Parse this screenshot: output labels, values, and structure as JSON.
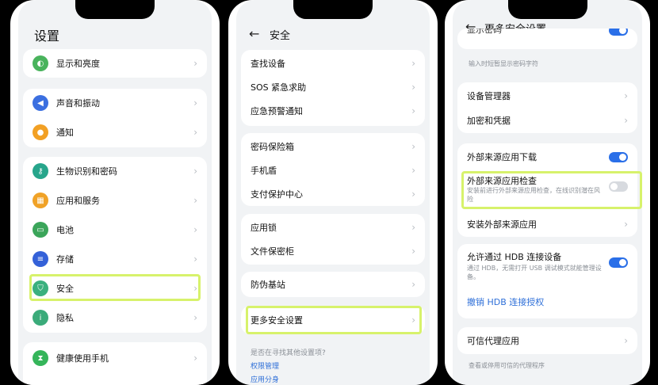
{
  "screen1": {
    "title": "设置",
    "groups": [
      [
        {
          "label": "显示和亮度",
          "icon": "display-icon",
          "color": "#49b35c"
        }
      ],
      [
        {
          "label": "声音和振动",
          "icon": "speaker-icon",
          "color": "#3b6fe0"
        },
        {
          "label": "通知",
          "icon": "bell-icon",
          "color": "#f2a024"
        }
      ],
      [
        {
          "label": "生物识别和密码",
          "icon": "key-icon",
          "color": "#27a58b"
        },
        {
          "label": "应用和服务",
          "icon": "apps-icon",
          "color": "#f0a227"
        },
        {
          "label": "电池",
          "icon": "battery-icon",
          "color": "#3ba55a"
        },
        {
          "label": "存储",
          "icon": "storage-icon",
          "color": "#3461d8"
        },
        {
          "label": "安全",
          "icon": "shield-icon",
          "color": "#3ab07e"
        },
        {
          "label": "隐私",
          "icon": "privacy-icon",
          "color": "#3bab7a"
        }
      ],
      [
        {
          "label": "健康使用手机",
          "icon": "hourglass-icon",
          "color": "#35b55a"
        }
      ]
    ]
  },
  "screen2": {
    "title": "安全",
    "groups": [
      [
        "查找设备",
        "SOS 紧急求助",
        "应急预警通知"
      ],
      [
        "密码保险箱",
        "手机盾",
        "支付保护中心"
      ],
      [
        "应用锁",
        "文件保密柜"
      ],
      [
        "防伪基站"
      ],
      [
        "更多安全设置"
      ]
    ],
    "footer_question": "是否在寻找其他设置项?",
    "footer_links": [
      "权限管理",
      "应用分身"
    ]
  },
  "screen3": {
    "title": "更多安全设置",
    "top_partial": "显示密码",
    "top_hint": "输入时短暂显示密码字符",
    "group1": [
      "设备管理器",
      "加密和凭据"
    ],
    "external_download": "外部来源应用下载",
    "external_check": "外部来源应用检查",
    "external_check_desc": "安装前进行外部来源应用检查，在线识别潜在风险",
    "install_external": "安装外部来源应用",
    "hdb_title": "允许通过 HDB 连接设备",
    "hdb_desc": "通过 HDB，无需打开 USB 调试模式就能管理设备。",
    "hdb_revoke": "撤销 HDB 连接授权",
    "trusted_agent": "可信代理应用",
    "trusted_agent_desc": "查看或停用可信的代理程序"
  }
}
